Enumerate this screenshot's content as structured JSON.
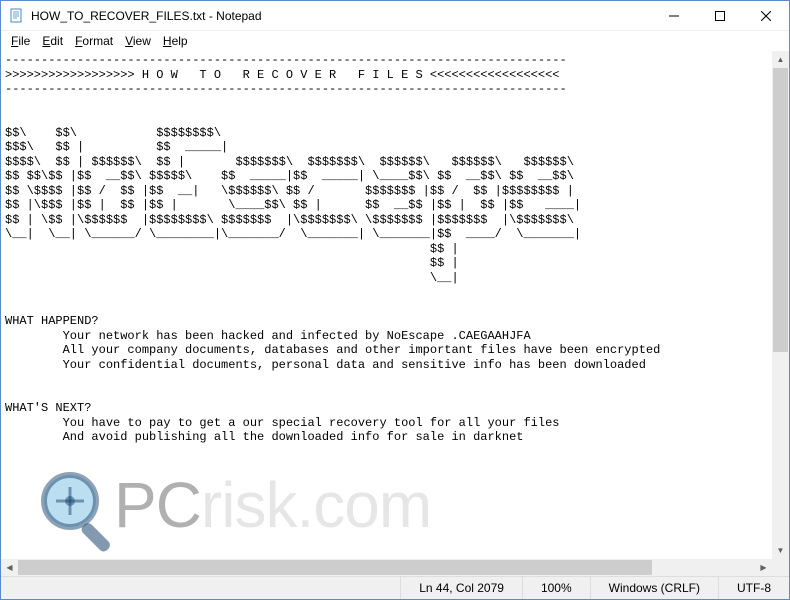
{
  "window": {
    "title": "HOW_TO_RECOVER_FILES.txt - Notepad"
  },
  "menu": {
    "file": "File",
    "edit": "Edit",
    "format": "Format",
    "view": "View",
    "help": "Help"
  },
  "document": {
    "text": "------------------------------------------------------------------------------\n>>>>>>>>>>>>>>>>>> H O W   T O   R E C O V E R   F I L E S <<<<<<<<<<<<<<<<<<\n------------------------------------------------------------------------------\n\n\n$$\\    $$\\           $$$$$$$$\\\n$$$\\   $$ |          $$  _____|\n$$$$\\  $$ | $$$$$$\\  $$ |       $$$$$$$\\  $$$$$$$\\  $$$$$$\\   $$$$$$\\   $$$$$$\\\n$$ $$\\$$ |$$  __$$\\ $$$$$\\    $$  _____|$$  _____| \\____$$\\ $$  __$$\\ $$  __$$\\\n$$ \\$$$$ |$$ /  $$ |$$  __|   \\$$$$$$\\ $$ /       $$$$$$$ |$$ /  $$ |$$$$$$$$ |\n$$ |\\$$$ |$$ |  $$ |$$ |       \\____$$\\ $$ |      $$  __$$ |$$ |  $$ |$$   ____|\n$$ | \\$$ |\\$$$$$$  |$$$$$$$$\\ $$$$$$$  |\\$$$$$$$\\ \\$$$$$$$ |$$$$$$$  |\\$$$$$$$\\\n\\__|  \\__| \\______/ \\________|\\_______/  \\_______| \\_______|$$  ____/  \\_______|\n                                                           $$ |\n                                                           $$ |\n                                                           \\__|\n\n\nWHAT HAPPEND?\n        Your network has been hacked and infected by NoEscape .CAEGAAHJFA\n        All your company documents, databases and other important files have been encrypted\n        Your confidential documents, personal data and sensitive info has been downloaded\n\n\nWHAT'S NEXT?\n        You have to pay to get a our special recovery tool for all your files\n        And avoid publishing all the downloaded info for sale in darknet\n"
  },
  "status": {
    "position": "Ln 44, Col 2079",
    "zoom": "100%",
    "line_ending": "Windows (CRLF)",
    "encoding": "UTF-8"
  },
  "watermark": {
    "brand_part1": "PC",
    "brand_part2": "risk.com"
  }
}
